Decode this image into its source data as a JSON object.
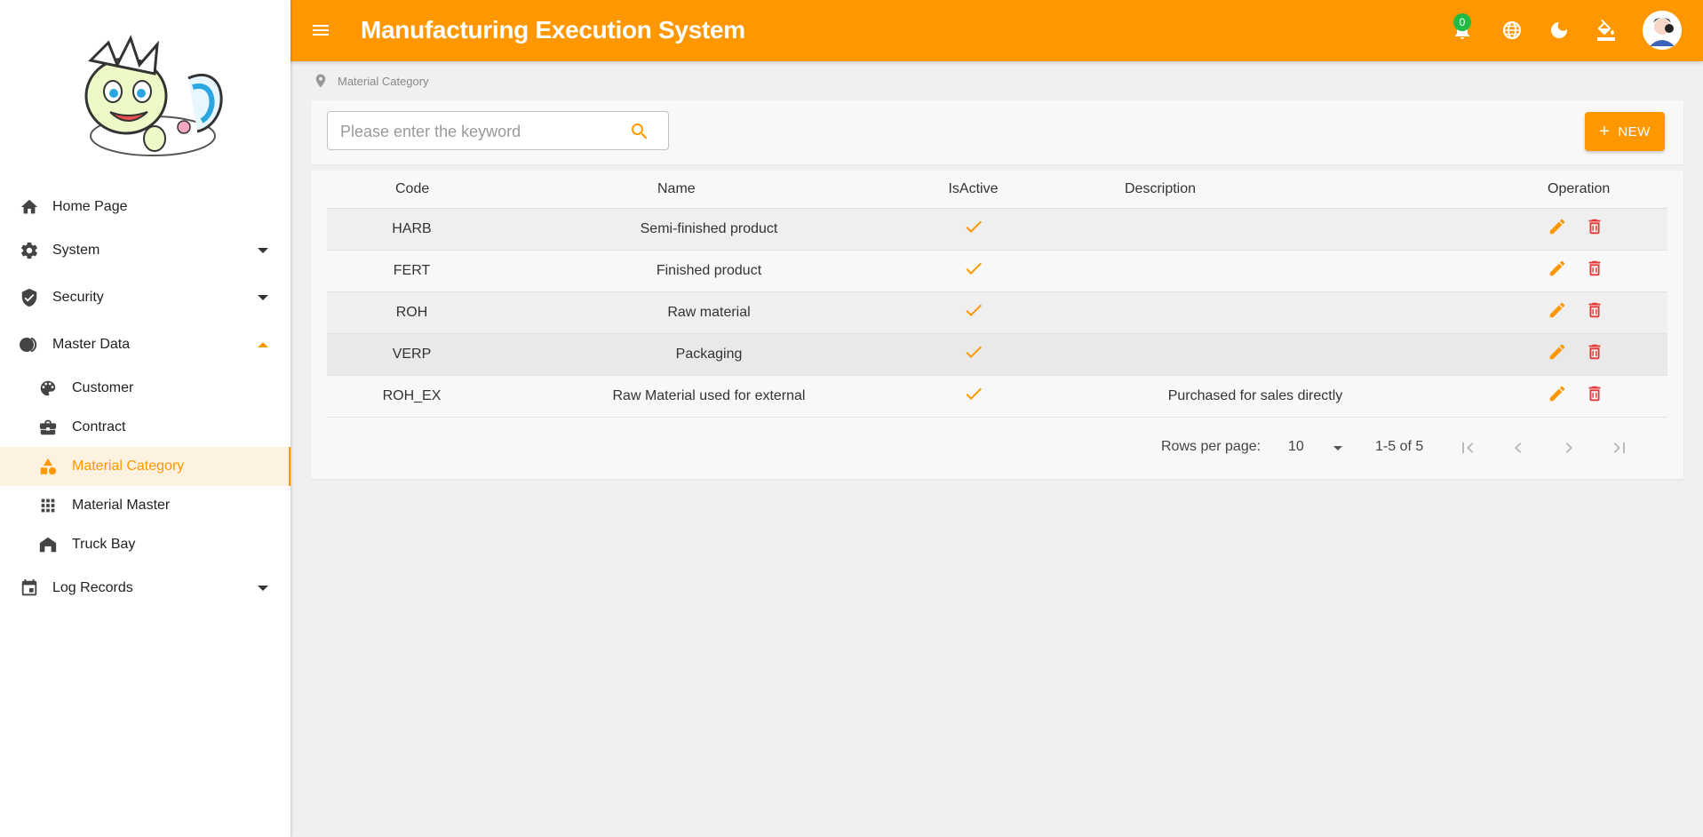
{
  "header": {
    "title": "Manufacturing Execution System",
    "notification_count": "0",
    "icons": [
      "menu-icon",
      "bell-icon",
      "globe-icon",
      "moon-icon",
      "paint-bucket-icon"
    ]
  },
  "sidebar": {
    "items": [
      {
        "label": "Home Page",
        "icon": "home-icon"
      },
      {
        "label": "System",
        "icon": "gear-icon",
        "expandable": true
      },
      {
        "label": "Security",
        "icon": "shield-icon",
        "expandable": true
      },
      {
        "label": "Master Data",
        "icon": "toggle-icon",
        "expandable": true,
        "expanded": true,
        "children": [
          {
            "label": "Customer",
            "icon": "palette-icon"
          },
          {
            "label": "Contract",
            "icon": "briefcase-icon"
          },
          {
            "label": "Material Category",
            "icon": "shapes-icon",
            "active": true
          },
          {
            "label": "Material Master",
            "icon": "grid-icon"
          },
          {
            "label": "Truck Bay",
            "icon": "garage-icon"
          }
        ]
      },
      {
        "label": "Log Records",
        "icon": "calendar-icon",
        "expandable": true
      }
    ]
  },
  "breadcrumb": {
    "current": "Material Category"
  },
  "search": {
    "placeholder": "Please enter the keyword",
    "value": ""
  },
  "toolbar": {
    "new_label": "NEW"
  },
  "table": {
    "columns": [
      "Code",
      "Name",
      "IsActive",
      "Description",
      "Operation"
    ],
    "rows": [
      {
        "code": "HARB",
        "name": "Semi-finished product",
        "is_active": true,
        "description": ""
      },
      {
        "code": "FERT",
        "name": "Finished product",
        "is_active": true,
        "description": ""
      },
      {
        "code": "ROH",
        "name": "Raw material",
        "is_active": true,
        "description": ""
      },
      {
        "code": "VERP",
        "name": "Packaging",
        "is_active": true,
        "description": ""
      },
      {
        "code": "ROH_EX",
        "name": "Raw Material used for external",
        "is_active": true,
        "description": "Purchased for sales directly"
      }
    ]
  },
  "pagination": {
    "rows_per_page_label": "Rows per page:",
    "rows_per_page": "10",
    "range": "1-5 of 5"
  },
  "colors": {
    "accent": "#ff9800",
    "delete": "#e53935",
    "badge": "#21ba45"
  }
}
